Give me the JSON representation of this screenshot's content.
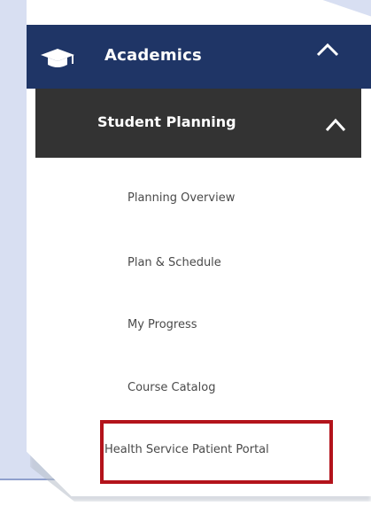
{
  "menu": {
    "academics_label": "Academics",
    "student_planning_label": "Student Planning",
    "items": [
      {
        "label": "Planning Overview"
      },
      {
        "label": "Plan & Schedule"
      },
      {
        "label": "My Progress"
      },
      {
        "label": "Course Catalog"
      },
      {
        "label": "Health Service Patient Portal"
      }
    ]
  },
  "icons": {
    "academics": "graduation-cap-icon",
    "academics_toggle": "chevron-up-icon",
    "student_planning_toggle": "chevron-up-icon"
  },
  "colors": {
    "academics_bg": "#1f3566",
    "student_planning_bg": "#333333",
    "highlight_border": "#b3131b",
    "menu_text": "#4a4a4a",
    "background": "#d8dff2"
  }
}
